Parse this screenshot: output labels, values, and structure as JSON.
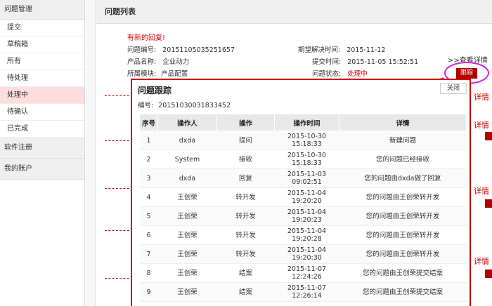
{
  "sidebar": {
    "header": "问题管理",
    "items": [
      "提交",
      "草稿箱",
      "所有",
      "待处理",
      "处理中",
      "待确认",
      "已完成"
    ],
    "active_index": 4,
    "sections": [
      "软件注册",
      "我的账户"
    ]
  },
  "main": {
    "title": "问题列表",
    "new_reply": "有新的回复!",
    "fields": {
      "id_label": "问题编号:",
      "id_value": "20151105035251657",
      "product_label": "产品名称:",
      "product_value": "企业动力",
      "module_label": "所属模块:",
      "module_value": "产品配置",
      "expected_label": "期望解决时间:",
      "expected_value": "2015-11-12",
      "submit_label": "提交时间:",
      "submit_value": "2015-11-05 15:52:51",
      "status_label": "问题状态:",
      "status_value": "处理中"
    },
    "view_detail": ">>查看详情",
    "track_button": "跟踪",
    "right_fragment": "详情"
  },
  "modal": {
    "title": "问题跟踪",
    "close": "关闭",
    "id_label": "编号:",
    "id_value": "20151030031833452",
    "columns": [
      "序号",
      "操作人",
      "操作",
      "操作时间",
      "详情"
    ],
    "rows": [
      {
        "seq": "1",
        "operator": "dxda",
        "action": "提问",
        "date": "2015-10-30",
        "time": "15:18:33",
        "detail": "新建问题"
      },
      {
        "seq": "2",
        "operator": "System",
        "action": "接收",
        "date": "2015-10-30",
        "time": "15:18:33",
        "detail": "您的问题已经接收"
      },
      {
        "seq": "3",
        "operator": "dxda",
        "action": "回复",
        "date": "2015-11-03",
        "time": "09:02:51",
        "detail": "您的问题由dxda做了回复"
      },
      {
        "seq": "4",
        "operator": "王创荣",
        "action": "转开发",
        "date": "2015-11-04",
        "time": "19:20:20",
        "detail": "您的问题由王创荣转开发"
      },
      {
        "seq": "5",
        "operator": "王创荣",
        "action": "转开发",
        "date": "2015-11-04",
        "time": "19:20:23",
        "detail": "您的问题由王创荣转开发"
      },
      {
        "seq": "6",
        "operator": "王创荣",
        "action": "转开发",
        "date": "2015-11-04",
        "time": "19:20:28",
        "detail": "您的问题由王创荣转开发"
      },
      {
        "seq": "7",
        "operator": "王创荣",
        "action": "转开发",
        "date": "2015-11-04",
        "time": "19:20:30",
        "detail": "您的问题由王创荣转开发"
      },
      {
        "seq": "8",
        "operator": "王创荣",
        "action": "结案",
        "date": "2015-11-07",
        "time": "12:24:26",
        "detail": "您的问题由王创荣提交结案"
      },
      {
        "seq": "9",
        "operator": "王创荣",
        "action": "结案",
        "date": "2015-11-07",
        "time": "12:26:14",
        "detail": "您的问题由王创荣提交结案"
      }
    ]
  },
  "colors": {
    "accent": "#b00000",
    "highlight": "#d020e0",
    "active_bg": "#ffdddd"
  }
}
